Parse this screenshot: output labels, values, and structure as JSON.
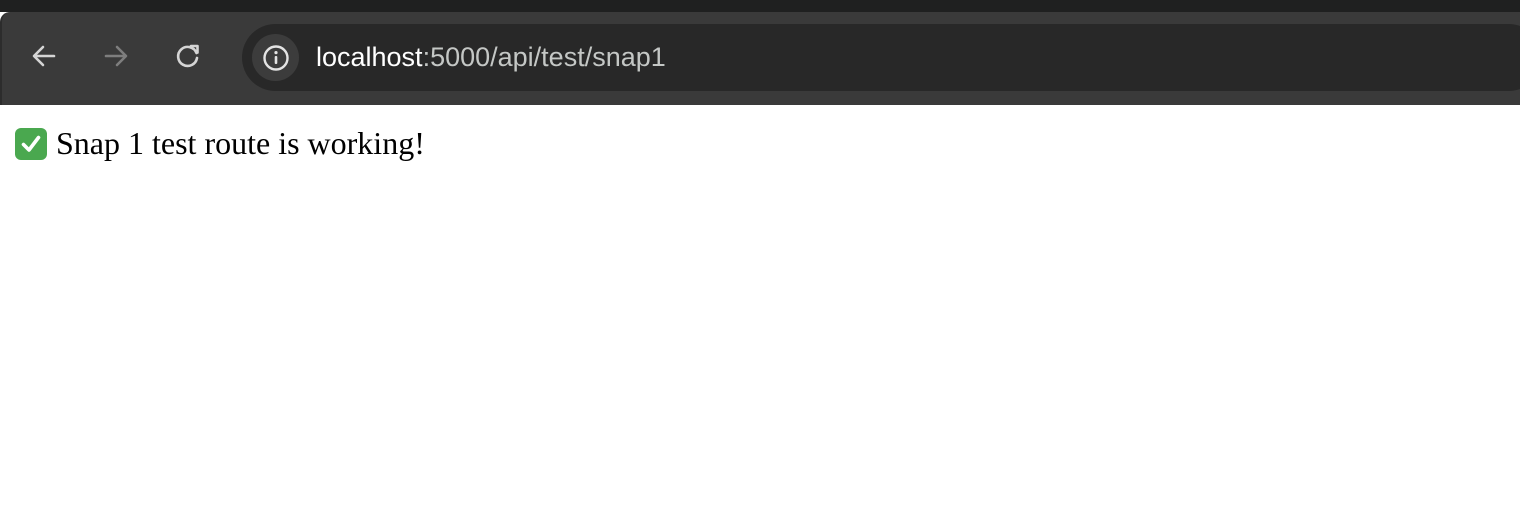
{
  "browser": {
    "url_host": "localhost",
    "url_rest": ":5000/api/test/snap1",
    "icons": {
      "back": "arrow-left-icon",
      "forward": "arrow-right-icon",
      "reload": "reload-icon",
      "site_info": "info-icon"
    },
    "colors": {
      "toolbar": "#3a3a3a",
      "omnibox": "#282828",
      "tabstrip": "#1f2020"
    }
  },
  "page": {
    "message": "Snap 1 test route is working!",
    "status_icon": "check-mark-button-icon",
    "status_icon_color": "#4aa84f"
  }
}
